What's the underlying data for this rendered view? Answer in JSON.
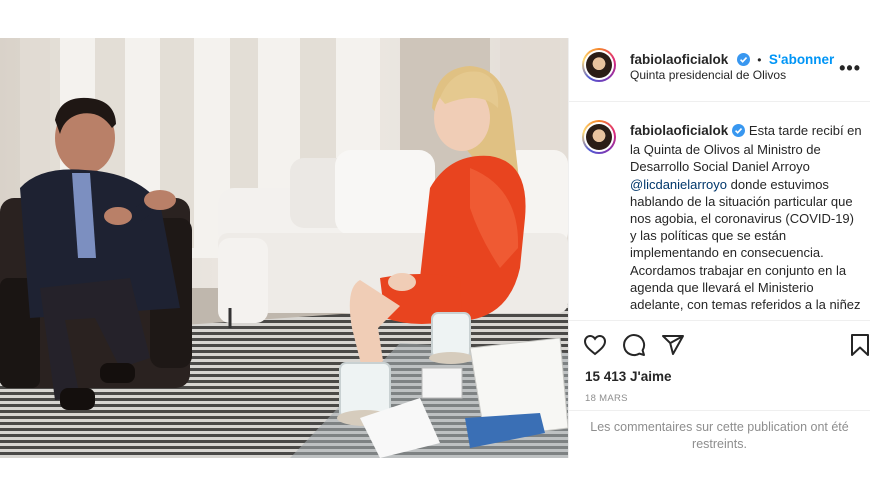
{
  "header": {
    "username": "fabiolaoficialok",
    "follow_label": "S'abonner",
    "separator": "•",
    "location": "Quinta presidencial de Olivos",
    "more_label": "•••"
  },
  "caption": {
    "username": "fabiolaoficialok",
    "text_before": "Esta tarde recibí en la Quinta de Olivos al Ministro de Desarrollo Social Daniel Arroyo ",
    "mention": "@licdanielarroyo",
    "text_after": " donde estuvimos hablando de la situación particular que nos agobia, el coronavirus (COVID-19) y las políticas que se están implementando en consecuencia. Acordamos trabajar en conjunto en la agenda que llevará el Ministerio adelante, con temas referidos a la niñez"
  },
  "stats": {
    "likes": "15 413 J'aime",
    "date": "18 MARS"
  },
  "footer": {
    "restricted": "Les commentaires sur cette publication ont été restreints."
  },
  "icons": [
    "heart-icon",
    "comment-icon",
    "share-icon",
    "bookmark-icon",
    "verified-badge-icon",
    "more-options-icon"
  ],
  "colors": {
    "link": "#0095f6",
    "mention": "#00376b",
    "muted": "#8e8e8e",
    "dress": "#e8441f"
  }
}
